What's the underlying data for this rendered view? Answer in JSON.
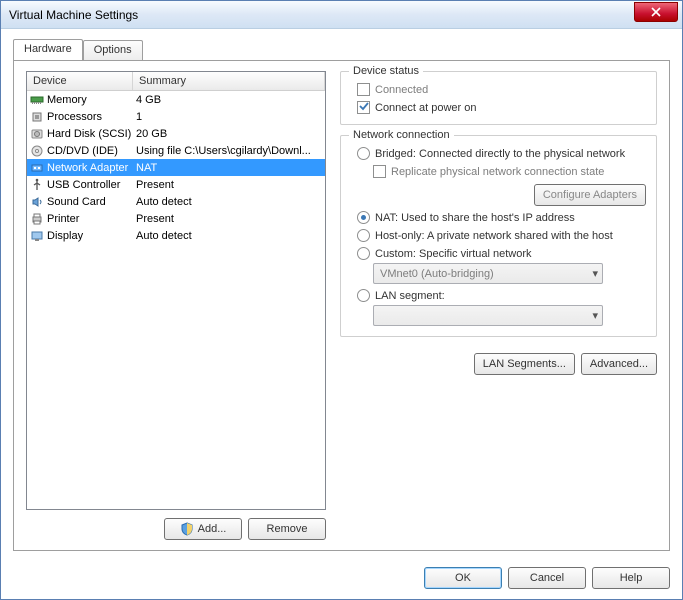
{
  "window": {
    "title": "Virtual Machine Settings"
  },
  "tabs": {
    "hardware": "Hardware",
    "options": "Options"
  },
  "list": {
    "header_device": "Device",
    "header_summary": "Summary",
    "rows": [
      {
        "device": "Memory",
        "summary": "4 GB"
      },
      {
        "device": "Processors",
        "summary": "1"
      },
      {
        "device": "Hard Disk (SCSI)",
        "summary": "20 GB"
      },
      {
        "device": "CD/DVD (IDE)",
        "summary": "Using file C:\\Users\\cgilardy\\Downl..."
      },
      {
        "device": "Network Adapter",
        "summary": "NAT"
      },
      {
        "device": "USB Controller",
        "summary": "Present"
      },
      {
        "device": "Sound Card",
        "summary": "Auto detect"
      },
      {
        "device": "Printer",
        "summary": "Present"
      },
      {
        "device": "Display",
        "summary": "Auto detect"
      }
    ]
  },
  "buttons": {
    "add": "Add...",
    "remove": "Remove",
    "ok": "OK",
    "cancel": "Cancel",
    "help": "Help",
    "lan_segments": "LAN Segments...",
    "advanced": "Advanced...",
    "configure_adapters": "Configure Adapters"
  },
  "device_status": {
    "title": "Device status",
    "connected": "Connected",
    "connect_at_power_on": "Connect at power on"
  },
  "network": {
    "title": "Network connection",
    "bridged": "Bridged: Connected directly to the physical network",
    "replicate": "Replicate physical network connection state",
    "nat": "NAT: Used to share the host's IP address",
    "hostonly": "Host-only: A private network shared with the host",
    "custom": "Custom: Specific virtual network",
    "custom_value": "VMnet0 (Auto-bridging)",
    "lan_segment": "LAN segment:",
    "lan_value": ""
  }
}
